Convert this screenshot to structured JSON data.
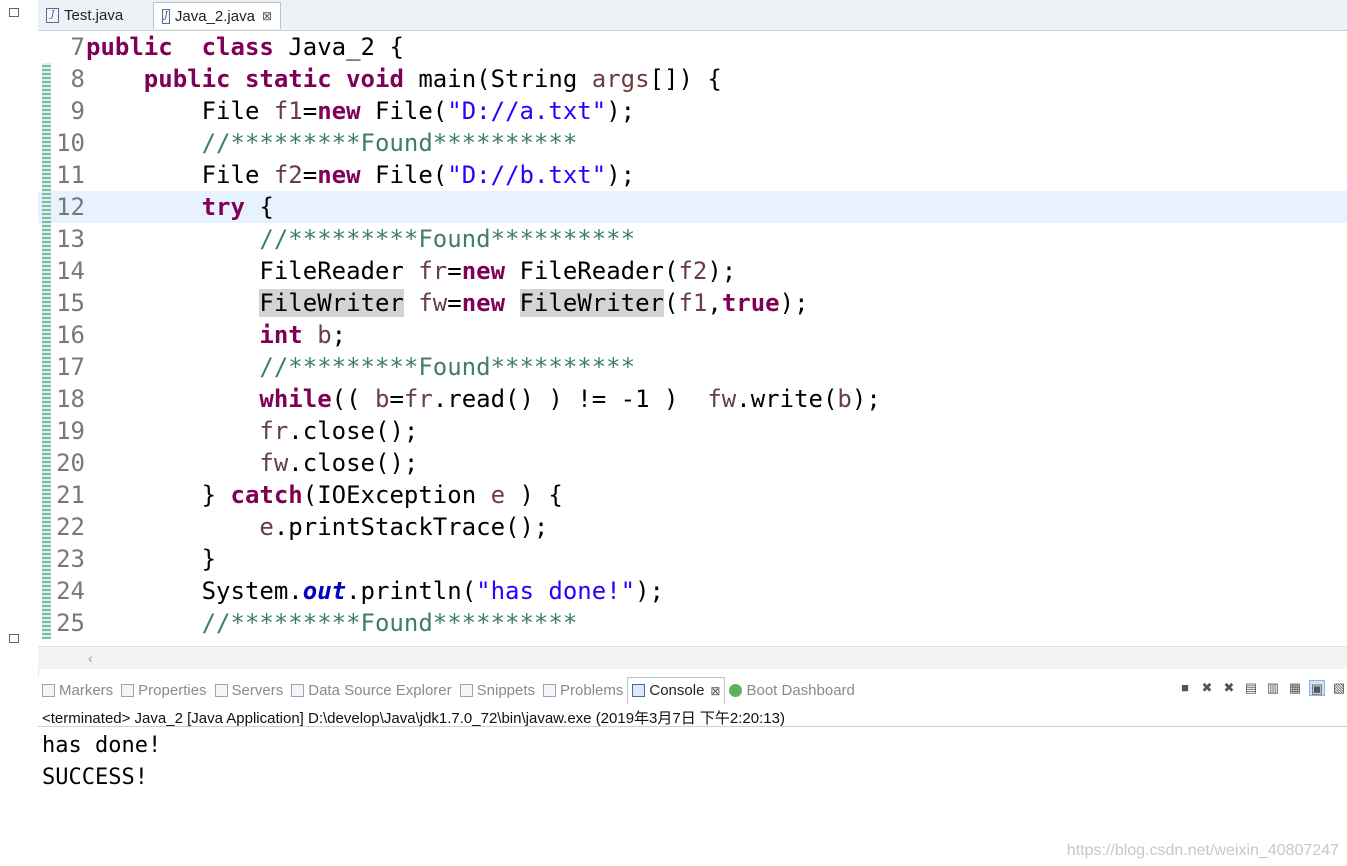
{
  "editor": {
    "tabs": [
      {
        "label": "Test.java",
        "active": false,
        "icon": "java-file-icon"
      },
      {
        "label": "Java_2.java",
        "active": true,
        "icon": "java-file-icon",
        "close": "⊠"
      }
    ],
    "current_line": 12,
    "lines": [
      {
        "num": "7",
        "tokens": [
          [
            "kw",
            "public"
          ],
          [
            "",
            "  "
          ],
          [
            "kw",
            "class"
          ],
          [
            "",
            " Java_2 {"
          ]
        ]
      },
      {
        "num": "8",
        "tokens": [
          [
            "",
            "    "
          ],
          [
            "kw",
            "public"
          ],
          [
            "",
            " "
          ],
          [
            "kw",
            "static"
          ],
          [
            "",
            " "
          ],
          [
            "kw",
            "void"
          ],
          [
            "",
            " main(String "
          ],
          [
            "lv",
            "args"
          ],
          [
            "",
            "[]) {"
          ]
        ]
      },
      {
        "num": "9",
        "tokens": [
          [
            "",
            "        File "
          ],
          [
            "lv",
            "f1"
          ],
          [
            "",
            "="
          ],
          [
            "kw",
            "new"
          ],
          [
            "",
            " File("
          ],
          [
            "st",
            "\"D://a.txt\""
          ],
          [
            "",
            ");"
          ]
        ]
      },
      {
        "num": "10",
        "tokens": [
          [
            "",
            "        "
          ],
          [
            "cm",
            "//*********Found**********"
          ]
        ]
      },
      {
        "num": "11",
        "tokens": [
          [
            "",
            "        File "
          ],
          [
            "lv",
            "f2"
          ],
          [
            "",
            "="
          ],
          [
            "kw",
            "new"
          ],
          [
            "",
            " File("
          ],
          [
            "st",
            "\"D://b.txt\""
          ],
          [
            "",
            ");"
          ]
        ]
      },
      {
        "num": "12",
        "tokens": [
          [
            "",
            "        "
          ],
          [
            "kw",
            "try"
          ],
          [
            "",
            " {"
          ]
        ]
      },
      {
        "num": "13",
        "tokens": [
          [
            "",
            "            "
          ],
          [
            "cm",
            "//*********Found**********"
          ]
        ]
      },
      {
        "num": "14",
        "tokens": [
          [
            "",
            "            FileReader "
          ],
          [
            "lv",
            "fr"
          ],
          [
            "",
            "="
          ],
          [
            "kw",
            "new"
          ],
          [
            "",
            " FileReader("
          ],
          [
            "lv",
            "f2"
          ],
          [
            "",
            ");"
          ]
        ]
      },
      {
        "num": "15",
        "tokens": [
          [
            "",
            "            "
          ],
          [
            "occ",
            "FileWriter"
          ],
          [
            "",
            " "
          ],
          [
            "lv",
            "fw"
          ],
          [
            "",
            "="
          ],
          [
            "kw",
            "new"
          ],
          [
            "",
            " "
          ],
          [
            "occ",
            "FileWriter"
          ],
          [
            "",
            "("
          ],
          [
            "lv",
            "f1"
          ],
          [
            "",
            ","
          ],
          [
            "kw",
            "true"
          ],
          [
            "",
            ");"
          ]
        ]
      },
      {
        "num": "16",
        "tokens": [
          [
            "",
            "            "
          ],
          [
            "kw",
            "int"
          ],
          [
            "",
            " "
          ],
          [
            "lv",
            "b"
          ],
          [
            "",
            ";"
          ]
        ]
      },
      {
        "num": "17",
        "tokens": [
          [
            "",
            "            "
          ],
          [
            "cm",
            "//*********Found**********"
          ]
        ]
      },
      {
        "num": "18",
        "tokens": [
          [
            "",
            "            "
          ],
          [
            "kw",
            "while"
          ],
          [
            "",
            "(( "
          ],
          [
            "lv",
            "b"
          ],
          [
            "",
            "="
          ],
          [
            "lv",
            "fr"
          ],
          [
            "",
            ".read() ) != -1 )  "
          ],
          [
            "lv",
            "fw"
          ],
          [
            "",
            ".write("
          ],
          [
            "lv",
            "b"
          ],
          [
            "",
            ");"
          ]
        ]
      },
      {
        "num": "19",
        "tokens": [
          [
            "",
            "            "
          ],
          [
            "lv",
            "fr"
          ],
          [
            "",
            ".close();"
          ]
        ]
      },
      {
        "num": "20",
        "tokens": [
          [
            "",
            "            "
          ],
          [
            "lv",
            "fw"
          ],
          [
            "",
            ".close();"
          ]
        ]
      },
      {
        "num": "21",
        "tokens": [
          [
            "",
            "        } "
          ],
          [
            "kw",
            "catch"
          ],
          [
            "",
            "(IOException "
          ],
          [
            "lv",
            "e"
          ],
          [
            "",
            " ) {"
          ]
        ]
      },
      {
        "num": "22",
        "tokens": [
          [
            "",
            "            "
          ],
          [
            "lv",
            "e"
          ],
          [
            "",
            ".printStackTrace();"
          ]
        ]
      },
      {
        "num": "23",
        "tokens": [
          [
            "",
            "        }"
          ]
        ]
      },
      {
        "num": "24",
        "tokens": [
          [
            "",
            "        System."
          ],
          [
            "fd",
            "out"
          ],
          [
            "",
            ".println("
          ],
          [
            "st",
            "\"has done!\""
          ],
          [
            "",
            ");"
          ]
        ]
      },
      {
        "num": "25",
        "tokens": [
          [
            "",
            "        "
          ],
          [
            "cm",
            "//*********Found**********"
          ]
        ]
      }
    ]
  },
  "views": {
    "tabs": [
      {
        "label": "Markers",
        "icon": "markers-icon",
        "active": false
      },
      {
        "label": "Properties",
        "icon": "properties-icon",
        "active": false
      },
      {
        "label": "Servers",
        "icon": "servers-icon",
        "active": false
      },
      {
        "label": "Data Source Explorer",
        "icon": "data-source-icon",
        "active": false
      },
      {
        "label": "Snippets",
        "icon": "snippets-icon",
        "active": false
      },
      {
        "label": "Problems",
        "icon": "problems-icon",
        "active": false
      },
      {
        "label": "Console",
        "icon": "console-icon",
        "active": true,
        "close": "⊠"
      },
      {
        "label": "Boot Dashboard",
        "icon": "boot-dashboard-icon",
        "active": false
      }
    ],
    "toolbar": [
      {
        "name": "terminate-icon",
        "glyph": "■"
      },
      {
        "name": "remove-launch-icon",
        "glyph": "✖"
      },
      {
        "name": "remove-all-icon",
        "glyph": "✖"
      },
      {
        "name": "scroll-lock-icon",
        "glyph": "▤"
      },
      {
        "name": "word-wrap-icon",
        "glyph": "▥"
      },
      {
        "name": "show-console-icon",
        "glyph": "▦"
      },
      {
        "name": "display-console-icon",
        "glyph": "▣",
        "selected": true
      },
      {
        "name": "open-console-icon",
        "glyph": "▧"
      }
    ]
  },
  "console": {
    "header": "<terminated> Java_2 [Java Application] D:\\develop\\Java\\jdk1.7.0_72\\bin\\javaw.exe (2019年3月7日 下午2:20:13)",
    "output": [
      "has done!",
      "SUCCESS!"
    ]
  },
  "watermark": "https://blog.csdn.net/weixin_40807247",
  "colors": {
    "keyword": "#7f0055",
    "comment": "#3f7f5f",
    "string": "#2a00ff",
    "field": "#0000c0",
    "local_variable": "#6a3e3e",
    "current_line": "#e8f2fe",
    "occurrence": "#d4d4d4"
  }
}
